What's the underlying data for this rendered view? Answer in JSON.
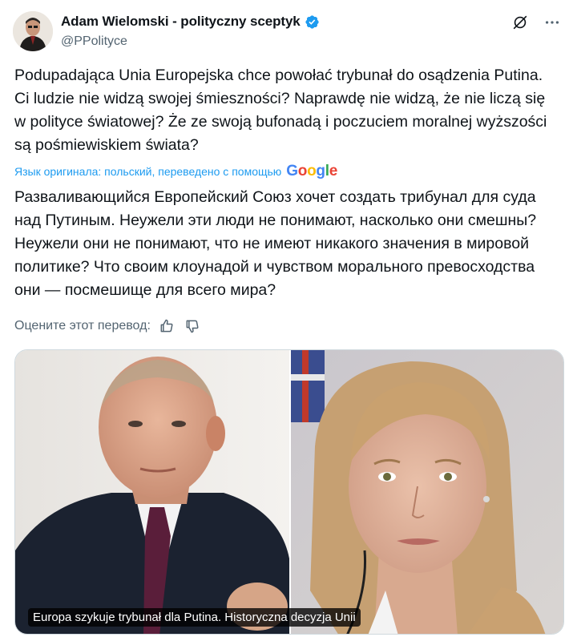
{
  "author": {
    "display_name": "Adam Wielomski - polityczny sceptyk",
    "handle": "@PPolityce"
  },
  "icons": {
    "verified": "verified-badge-icon",
    "grok": "grok-icon",
    "more": "more-options-icon",
    "like_translation": "thumbs-up-icon",
    "dislike_translation": "thumbs-down-icon"
  },
  "post": {
    "text": "Podupadająca Unia Europejska chce powołać trybunał do osądzenia Putina. Ci ludzie nie widzą swojej śmieszności? Naprawdę nie widzą, że nie liczą się w polityce światowej? Że ze swoją bufonadą i poczuciem moralnej wyższości są pośmiewiskiem świata?"
  },
  "translation": {
    "notice": "Язык оригинала: польский, переведено с помощью",
    "provider": "Google",
    "text": "Разваливающийся Европейский Союз хочет создать трибунал для суда над Путиным. Неужели эти люди не понимают, насколько они смешны? Неужели они не понимают, что не имеют никакого значения в мировой политике? Что своим клоунадой и чувством морального превосходства они — посмешище для всего мира?",
    "rate_label": "Оцените этот перевод:"
  },
  "media": {
    "caption": "Europa szykuje trybunał dla Putina. Historyczna decyzja Unii"
  },
  "colors": {
    "accent": "#1d9bf0",
    "text": "#0f1419",
    "secondary": "#536471"
  }
}
